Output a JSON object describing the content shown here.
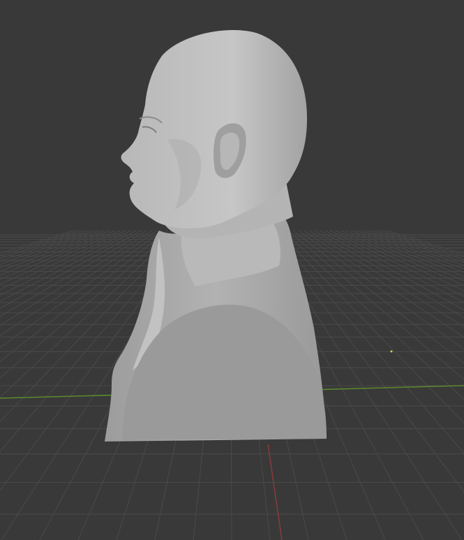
{
  "viewport": {
    "background_color": "#393939",
    "grid_color": "#4a4a4a",
    "x_axis_color": "#8a3b3b",
    "y_axis_color": "#5b8a2e",
    "model_color": "#a9a9a9",
    "model_shadow_color": "#8f8f8f",
    "model_highlight_color": "#c4c4c4",
    "origin_marker_color": "#d6cf40"
  },
  "scene": {
    "object": "bust-model",
    "view": "side-profile",
    "grid_visible": true,
    "axes_visible": [
      "x",
      "y"
    ]
  }
}
